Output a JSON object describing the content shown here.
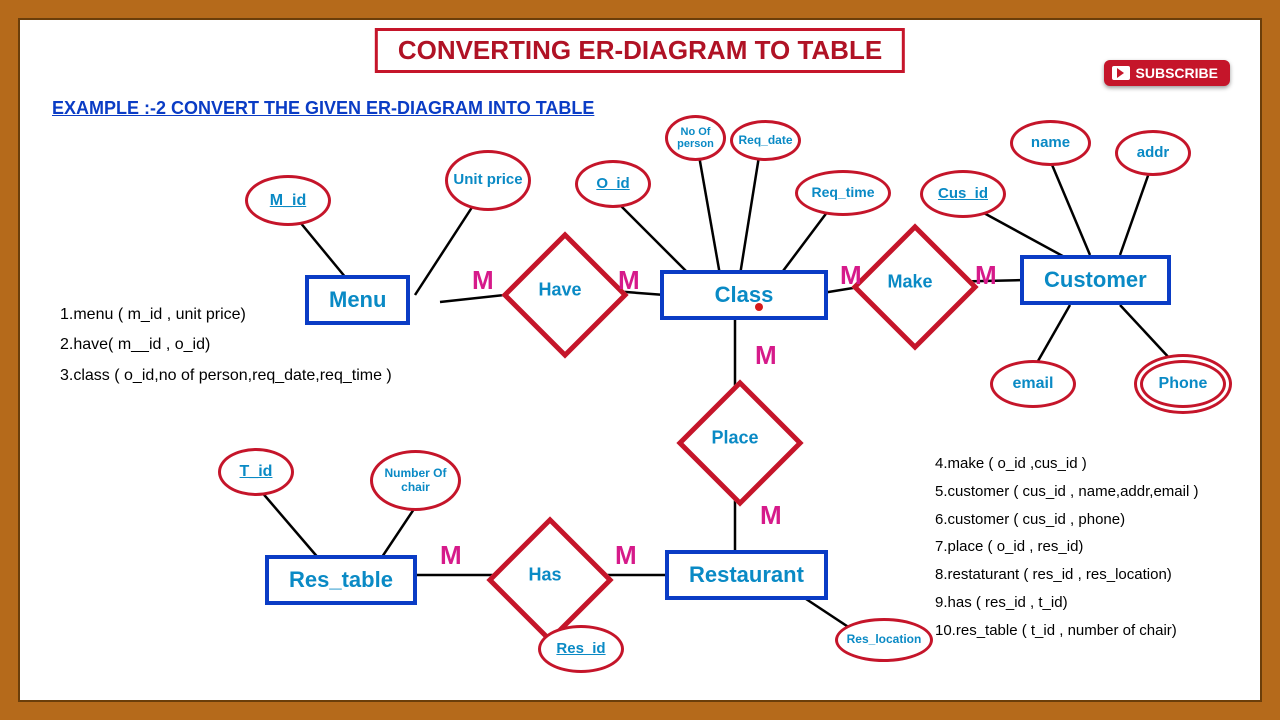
{
  "title": "CONVERTING ER-DIAGRAM TO TABLE",
  "subtitle": "EXAMPLE :-2    CONVERT THE  GIVEN ER-DIAGRAM INTO TABLE",
  "subscribe": "SUBSCRIBE",
  "entities": {
    "menu": "Menu",
    "class": "Class",
    "customer": "Customer",
    "res_table": "Res_table",
    "restaurant": "Restaurant"
  },
  "relations": {
    "have": "Have",
    "make": "Make",
    "place": "Place",
    "has": "Has"
  },
  "attrs": {
    "m_id": "M_id",
    "unit_price": "Unit price",
    "o_id": "O_id",
    "no_person": "No Of person",
    "req_date": "Req_date",
    "req_time": "Req_time",
    "cus_id": "Cus_id",
    "name": "name",
    "addr": "addr",
    "email": "email",
    "phone": "Phone",
    "t_id": "T_id",
    "num_chair": "Number Of chair",
    "res_id": "Res_id",
    "res_location": "Res_location"
  },
  "card": "M",
  "notes_left": {
    "l1": "1.menu ( m_id , unit price)",
    "l2": "2.have( m__id   , o_id)",
    "l3": "3.class ( o_id,no of person,req_date,req_time )"
  },
  "notes_right": {
    "l4": "4.make ( o_id ,cus_id )",
    "l5": "5.customer ( cus_id , name,addr,email )",
    "l6": "6.customer ( cus_id , phone)",
    "l7": "7.place ( o_id , res_id)",
    "l8": "8.restaturant ( res_id , res_location)",
    "l9": "9.has ( res_id , t_id)",
    "l10": "10.res_table ( t_id  , number of chair)"
  }
}
